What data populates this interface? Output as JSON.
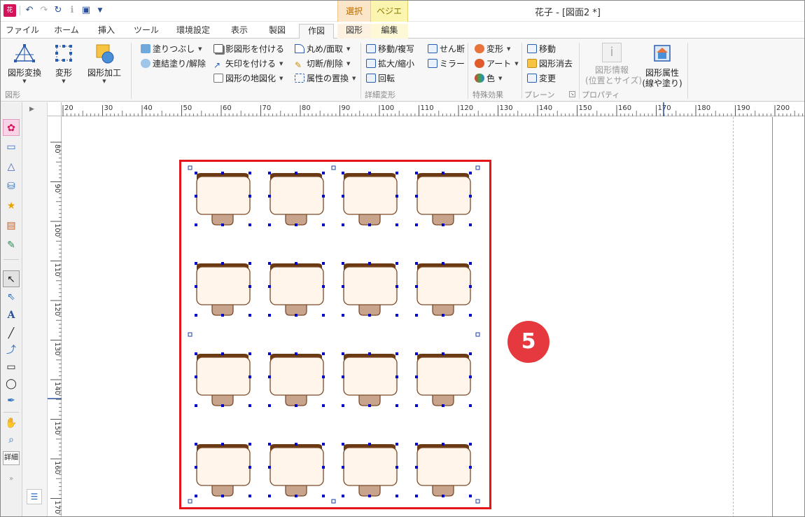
{
  "app": {
    "window_title": "花子 - [図面2 *]",
    "context_tabs": {
      "select": "選択",
      "bezier": "ベジエ"
    }
  },
  "ribbon_tabs": [
    "ファイル",
    "ホーム",
    "挿入",
    "ツール",
    "環境設定",
    "表示",
    "製図",
    "作図",
    "図形",
    "編集"
  ],
  "active_tab": "作図",
  "ribbon": {
    "group_zukei": {
      "label": "図形",
      "convert": "図形変換",
      "deform": "変形",
      "process": "図形加工"
    },
    "group_paint": {
      "fill": "塗りつぶし",
      "continuous_fill": "連結塗り/解除",
      "add_shadow": "影図形を付ける",
      "add_arrow": "矢印を付ける",
      "map_shape": "図形の地図化",
      "round_chamfer": "丸め/面取",
      "cut_delete": "切断/削除",
      "replace_attr": "属性の置換"
    },
    "group_detail": {
      "label": "詳細変形",
      "move_copy": "移動/複写",
      "scale": "拡大/縮小",
      "rotate": "回転",
      "shear": "せん断",
      "mirror": "ミラー"
    },
    "group_effect": {
      "label": "特殊効果",
      "deform": "変形",
      "art": "アート",
      "color": "色"
    },
    "group_plane": {
      "label": "プレーン",
      "move": "移動",
      "erase": "図形消去",
      "change": "変更"
    },
    "group_property": {
      "label": "プロパティ",
      "shape_info_line1": "図形情報",
      "shape_info_line2": "(位置とサイズ)",
      "shape_attr_line1": "図形属性",
      "shape_attr_line2": "(線や塗り)"
    }
  },
  "toolbar": {
    "detail_label": "詳細"
  },
  "rulers": {
    "horizontal": [
      "20",
      "30",
      "40",
      "50",
      "60",
      "70",
      "80",
      "90",
      "100",
      "110",
      "120",
      "130",
      "140",
      "150",
      "160",
      "170",
      "180",
      "190",
      "200"
    ],
    "vertical": [
      "80",
      "90",
      "100",
      "110",
      "120",
      "130",
      "140",
      "150",
      "160",
      "170"
    ]
  },
  "canvas": {
    "step_badge": "5",
    "desk_grid": {
      "rows": 4,
      "columns": 4
    },
    "colors": {
      "highlight": "#e4141b",
      "badge": "#e5393f",
      "desk_top": "#6b3a12",
      "desk_face": "#fff5ea",
      "chair": "#c9a48c",
      "handles": "#0000c8"
    }
  }
}
